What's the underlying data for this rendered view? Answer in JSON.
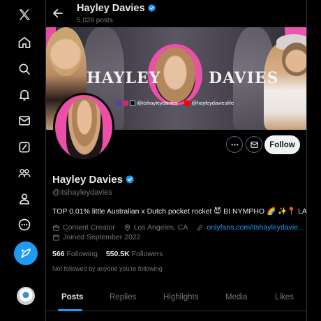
{
  "nav": {
    "items": [
      "x-logo-icon",
      "home-icon",
      "explore-icon",
      "notifications-icon",
      "messages-icon",
      "grok-icon",
      "communities-icon",
      "profile-icon",
      "more-icon"
    ],
    "compose": "compose-post-icon"
  },
  "header": {
    "name": "Hayley Davies",
    "post_count": "5,028 posts"
  },
  "banner": {
    "name_left": "HAYLEY",
    "name_right": "DAVIES",
    "handle_1": "@itshayleydavies",
    "handle_2": "@hayleydavieslife"
  },
  "actions": {
    "follow_label": "Follow"
  },
  "profile": {
    "name": "Hayley Davies",
    "handle": "@itshayleydavies",
    "bio": "TOP 0.01% little Australian x Dutch pocket rocket 😈 BI NYMPHO 🌈 ✨📍 LA",
    "category": "Content Creator",
    "location": "Los Angeles, CA",
    "link": "onlyfans.com/itshayleydavie…",
    "joined": "Joined September 2022",
    "following_count": "566",
    "following_label": "Following",
    "followers_count": "550.5K",
    "followers_label": "Followers",
    "not_followed": "Not followed by anyone you're following"
  },
  "tabs": [
    "Posts",
    "Replies",
    "Highlights",
    "Media",
    "Likes"
  ],
  "colors": {
    "accent": "#1d9bf0",
    "background": "#000000",
    "text_primary": "#e7e9ea",
    "text_secondary": "#71767b",
    "banner_pink": "#ec4fa8"
  }
}
